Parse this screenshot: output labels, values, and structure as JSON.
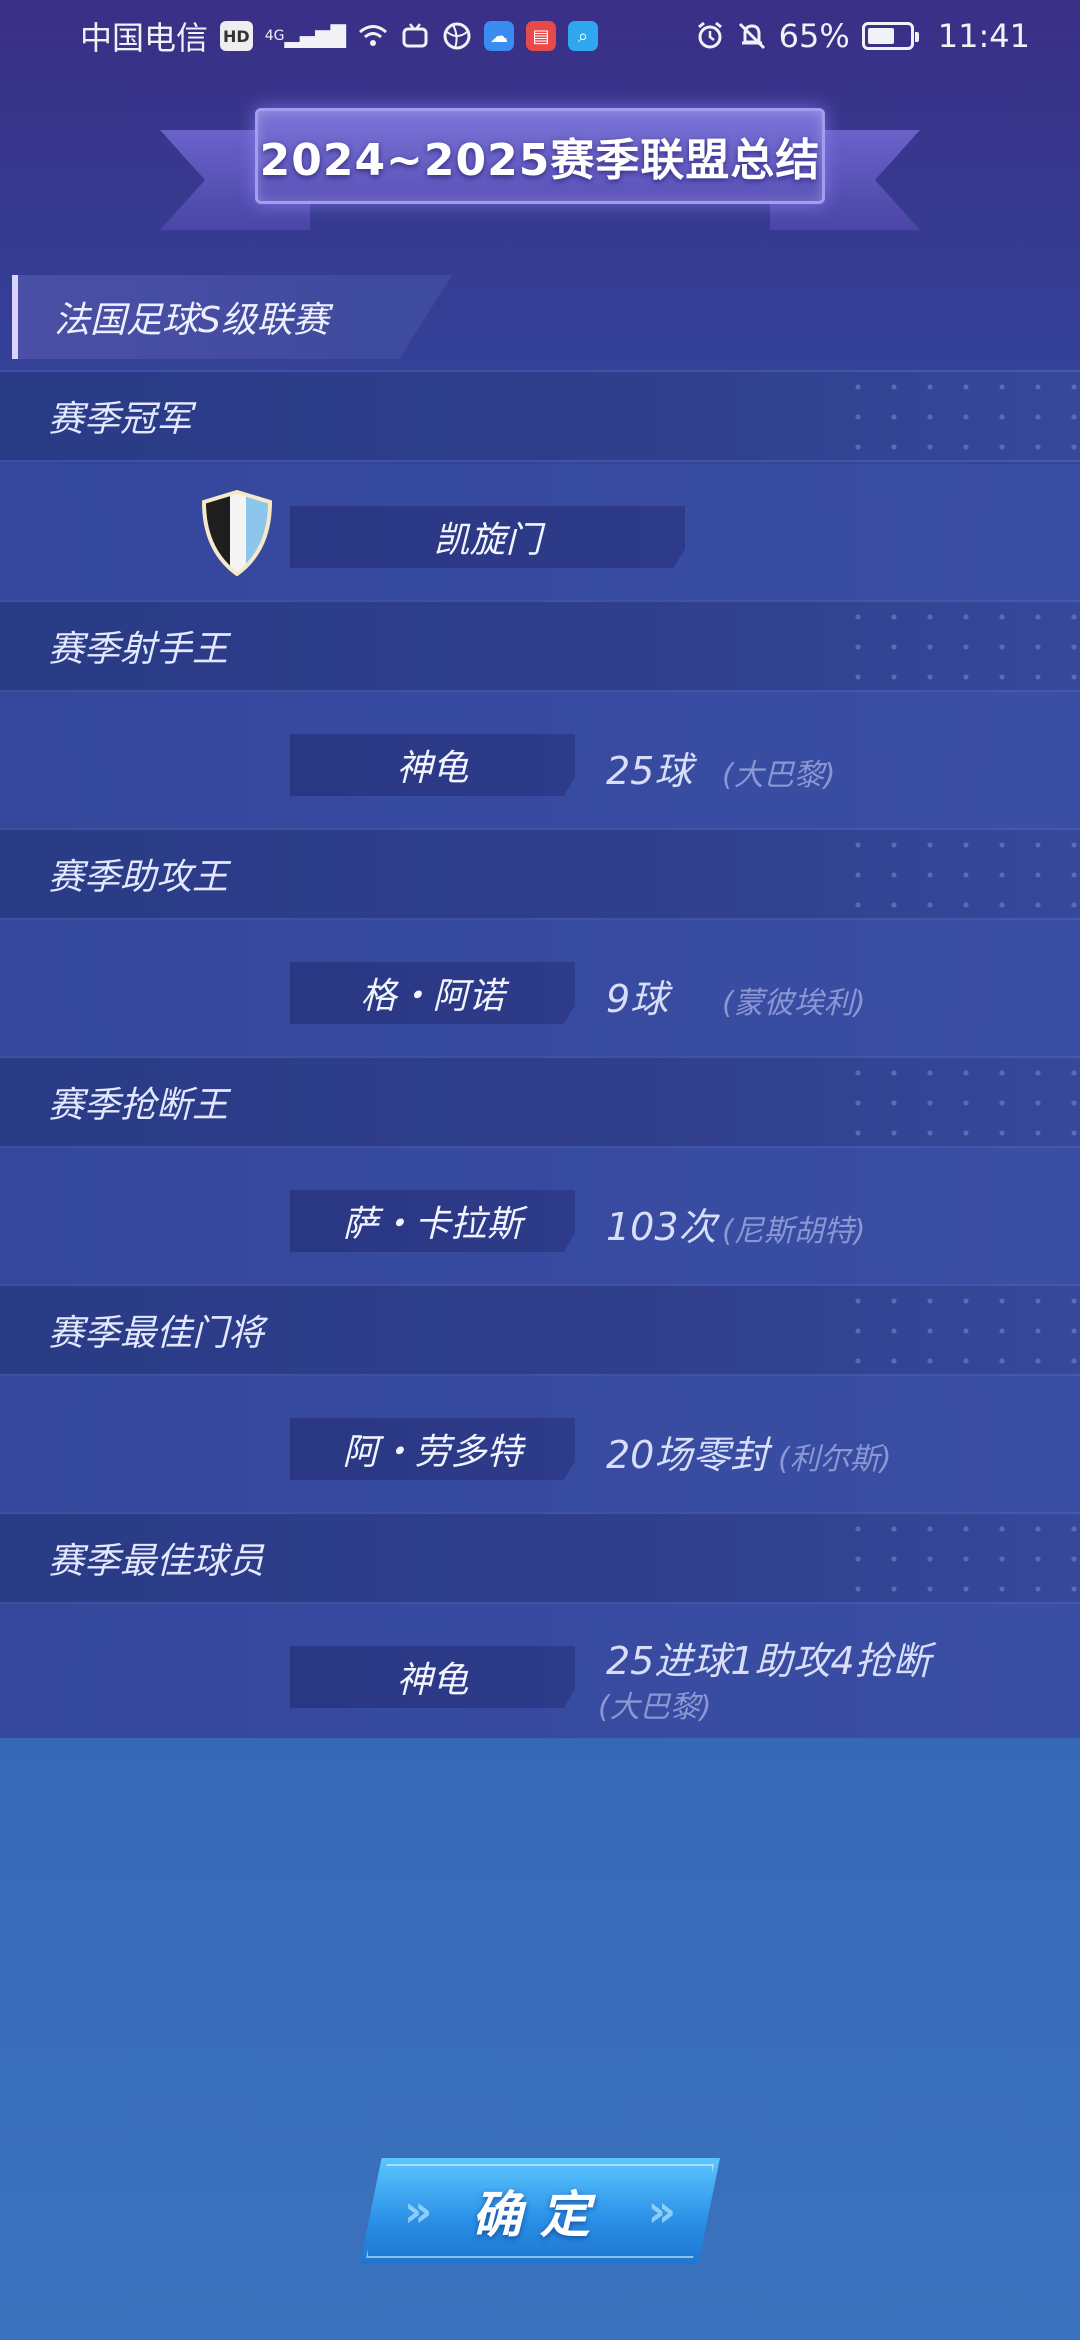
{
  "status_bar": {
    "carrier": "中国电信",
    "hd": "HD",
    "network": "4G",
    "battery": "65%",
    "battery_level": 0.65,
    "time": "11:41"
  },
  "banner": {
    "title": "2024~2025赛季联盟总结"
  },
  "league": {
    "name": "法国足球S级联赛"
  },
  "sections": {
    "champion": {
      "title": "赛季冠军",
      "team": "凯旋门",
      "shield_colors": [
        "#1e1e1e",
        "#f5f5f5",
        "#8cc6ea"
      ]
    },
    "top_scorer": {
      "title": "赛季射手王",
      "player": "神龟",
      "stat": "25球",
      "club": "(大巴黎)"
    },
    "top_assist": {
      "title": "赛季助攻王",
      "player": "格・阿诺",
      "stat": "9球",
      "club": "(蒙彼埃利)"
    },
    "top_tackle": {
      "title": "赛季抢断王",
      "player": "萨・卡拉斯",
      "stat": "103次",
      "club": "(尼斯胡特)"
    },
    "best_keeper": {
      "title": "赛季最佳门将",
      "player": "阿・劳多特",
      "stat": "20场零封",
      "club": "(利尔斯)"
    },
    "best_player": {
      "title": "赛季最佳球员",
      "player": "神龟",
      "stat": "25进球1助攻4抢断",
      "club": "(大巴黎)"
    }
  },
  "confirm_button": {
    "label": "确定"
  }
}
